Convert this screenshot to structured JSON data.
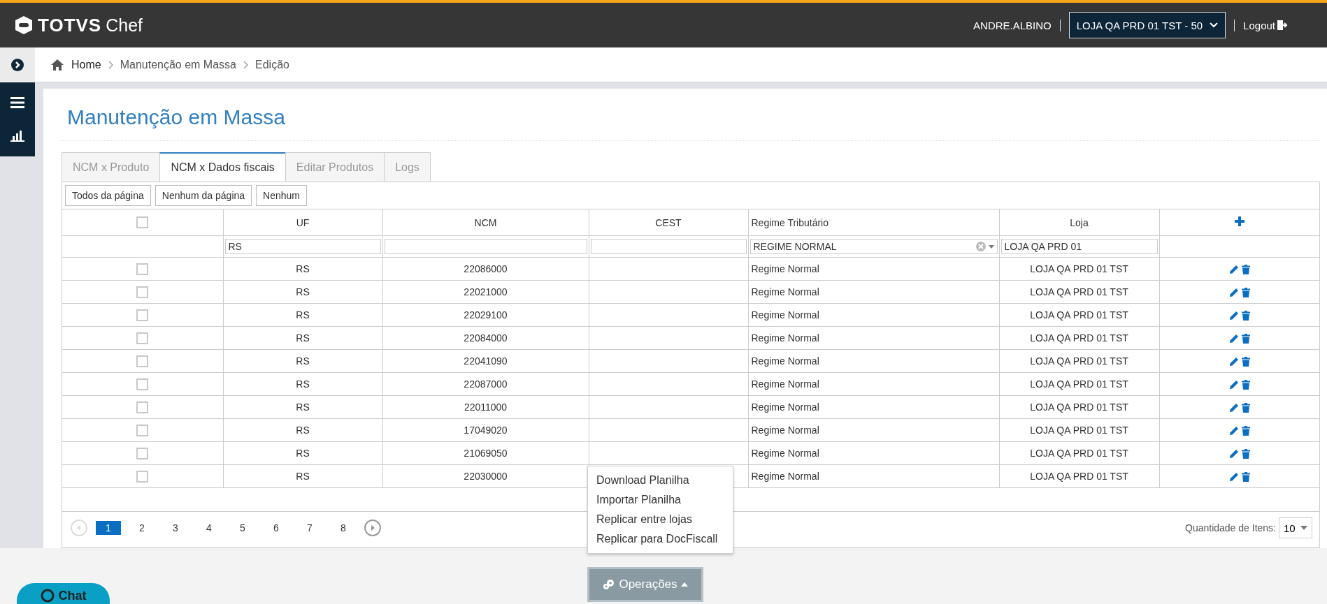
{
  "header": {
    "logo_text": "TOTVS",
    "product": "Chef",
    "user": "ANDRE.ALBINO",
    "store_select": "LOJA QA PRD 01 TST - 50",
    "logout": "Logout"
  },
  "breadcrumb": [
    "Home",
    "Manutenção em Massa",
    "Edição"
  ],
  "page_title": "Manutenção em Massa",
  "tabs": [
    {
      "label": "NCM x Produto",
      "selected": false
    },
    {
      "label": "NCM x Dados fiscais",
      "selected": true
    },
    {
      "label": "Editar Produtos",
      "selected": false
    },
    {
      "label": "Logs",
      "selected": false
    }
  ],
  "selection_buttons": [
    "Todos da página",
    "Nenhum da página",
    "Nenhum"
  ],
  "table": {
    "columns": [
      {
        "kind": "checkbox",
        "checked": false
      },
      {
        "kind": "text",
        "label": "UF"
      },
      {
        "kind": "text",
        "label": "NCM"
      },
      {
        "kind": "text",
        "label": "CEST"
      },
      {
        "kind": "text",
        "label": "Regime Tributário"
      },
      {
        "kind": "text",
        "label": "Loja"
      },
      {
        "kind": "add"
      }
    ],
    "filters": {
      "uf": "RS",
      "regime": "REGIME NORMAL",
      "loja": "LOJA QA PRD 01"
    },
    "rows": [
      {
        "checked": false,
        "uf": "RS",
        "ncm": "22086000",
        "regime": "Regime Normal",
        "loja": "LOJA QA PRD 01 TST"
      },
      {
        "checked": false,
        "uf": "RS",
        "ncm": "22021000",
        "regime": "Regime Normal",
        "loja": "LOJA QA PRD 01 TST"
      },
      {
        "checked": false,
        "uf": "RS",
        "ncm": "22029100",
        "regime": "Regime Normal",
        "loja": "LOJA QA PRD 01 TST"
      },
      {
        "checked": false,
        "uf": "RS",
        "ncm": "22084000",
        "regime": "Regime Normal",
        "loja": "LOJA QA PRD 01 TST"
      },
      {
        "checked": false,
        "uf": "RS",
        "ncm": "22041090",
        "regime": "Regime Normal",
        "loja": "LOJA QA PRD 01 TST"
      },
      {
        "checked": false,
        "uf": "RS",
        "ncm": "22087000",
        "regime": "Regime Normal",
        "loja": "LOJA QA PRD 01 TST"
      },
      {
        "checked": false,
        "uf": "RS",
        "ncm": "22011000",
        "regime": "Regime Normal",
        "loja": "LOJA QA PRD 01 TST"
      },
      {
        "checked": false,
        "uf": "RS",
        "ncm": "17049020",
        "regime": "Regime Normal",
        "loja": "LOJA QA PRD 01 TST"
      },
      {
        "checked": false,
        "uf": "RS",
        "ncm": "21069050",
        "regime": "Regime Normal",
        "loja": "LOJA QA PRD 01 TST"
      },
      {
        "checked": false,
        "uf": "RS",
        "ncm": "22030000",
        "regime": "Regime Normal",
        "loja": "LOJA QA PRD 01 TST"
      }
    ]
  },
  "pagination": {
    "pages": [
      {
        "label": "1",
        "selected": true
      },
      {
        "label": "2",
        "selected": false
      },
      {
        "label": "3",
        "selected": false
      },
      {
        "label": "4",
        "selected": false
      },
      {
        "label": "5",
        "selected": false
      },
      {
        "label": "6",
        "selected": false
      },
      {
        "label": "7",
        "selected": false
      },
      {
        "label": "8",
        "selected": false
      }
    ],
    "items_label": "Quantidade de Itens:",
    "items_per_page": "10"
  },
  "operations": {
    "label": "Operações",
    "expanded": true,
    "menu": [
      "Download Planilha",
      "Importar Planilha",
      "Replicar entre lojas",
      "Replicar para DocFiscall"
    ]
  },
  "chat": {
    "label": "Chat"
  }
}
